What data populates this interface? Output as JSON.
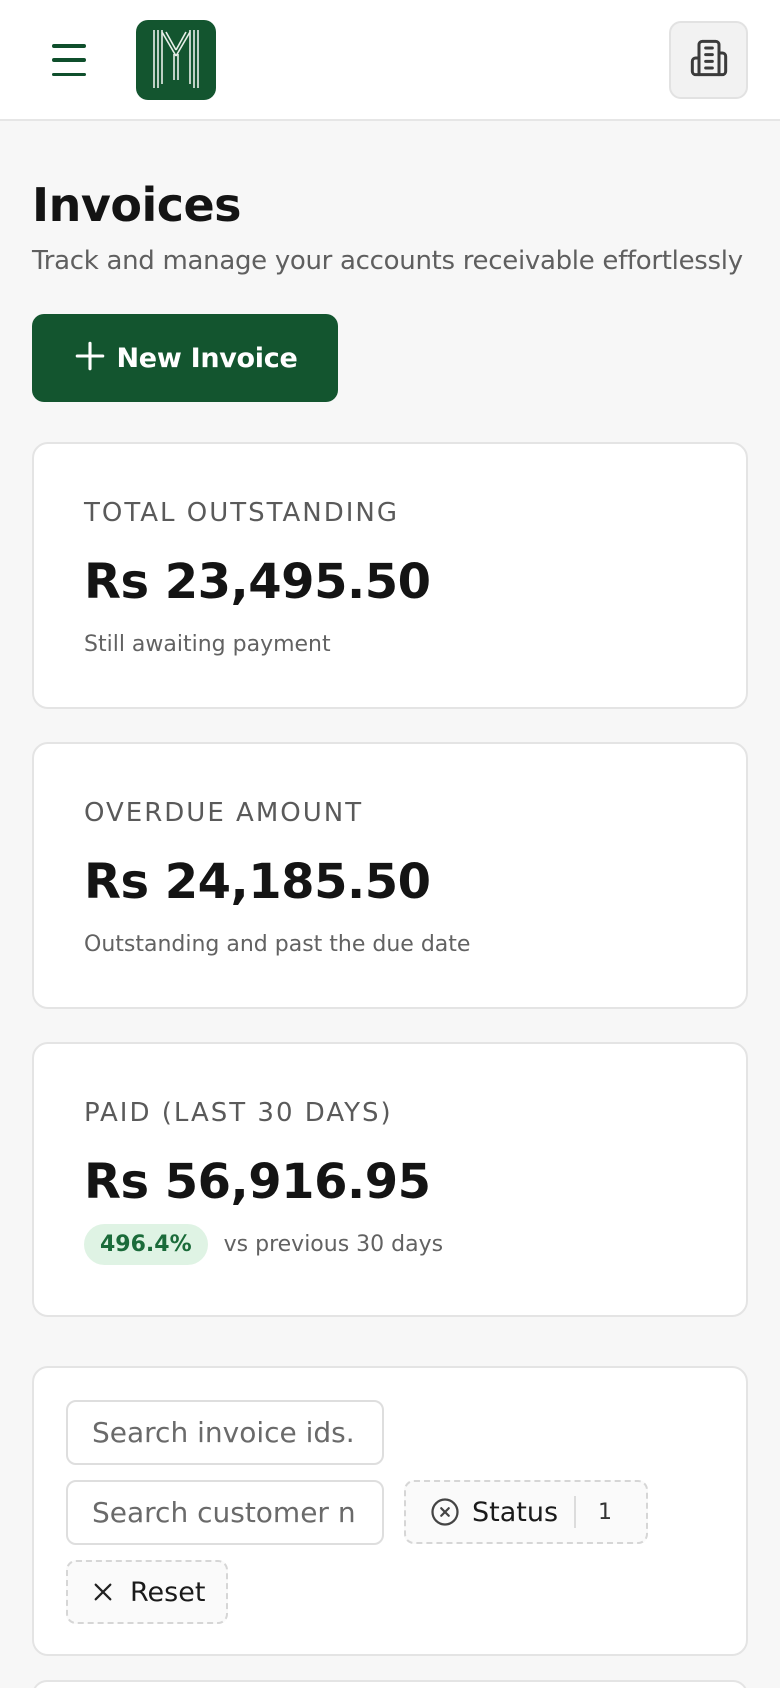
{
  "header": {
    "menu_icon": "hamburger-menu-icon",
    "logo_icon": "brand-logo",
    "org_icon": "building-icon",
    "brand_color": "#13552f"
  },
  "page": {
    "title": "Invoices",
    "subtitle": "Track and manage your accounts receivable effortlessly",
    "new_button_label": "New Invoice"
  },
  "stats": [
    {
      "label": "TOTAL OUTSTANDING",
      "value": "Rs 23,495.50",
      "note": "Still awaiting payment"
    },
    {
      "label": "OVERDUE AMOUNT",
      "value": "Rs 24,185.50",
      "note": "Outstanding and past the due date"
    },
    {
      "label": "PAID (LAST 30 DAYS)",
      "value": "Rs 56,916.95",
      "badge": "496.4%",
      "note": "vs previous 30 days"
    }
  ],
  "filters": {
    "invoice_search_placeholder": "Search invoice ids.",
    "customer_search_placeholder": "Search customer n",
    "status_label": "Status",
    "status_count": "1",
    "reset_label": "Reset"
  }
}
